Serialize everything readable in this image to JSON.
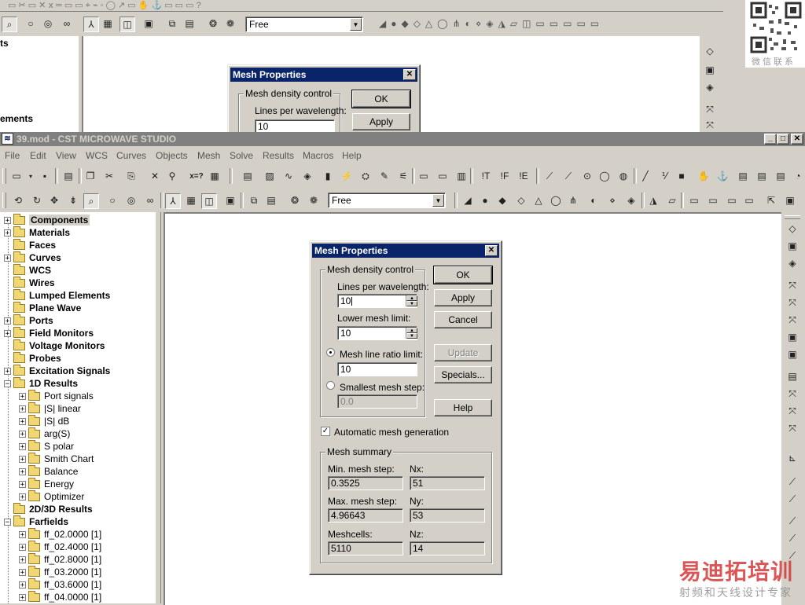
{
  "background_window": {
    "tree_partial": [
      "ts",
      "ements"
    ],
    "combo_value": "Free",
    "dialog": {
      "title": "Mesh Properties",
      "group_label": "Mesh density control",
      "lines_label": "Lines per wavelength:",
      "lines_value": "10",
      "ok": "OK",
      "apply": "Apply"
    }
  },
  "watermark": {
    "qr_caption": "微信联系",
    "brand": "易迪拓培训",
    "tagline": "射频和天线设计专家"
  },
  "window": {
    "title": "39.mod - CST MICROWAVE STUDIO",
    "controls": [
      "_",
      "□",
      "✕"
    ]
  },
  "menu": [
    "File",
    "Edit",
    "View",
    "WCS",
    "Curves",
    "Objects",
    "Mesh",
    "Solve",
    "Results",
    "Macros",
    "Help"
  ],
  "toolbar": {
    "combo_value": "Free"
  },
  "tree": {
    "items": [
      {
        "label": "Components",
        "expand": "+",
        "bold": true,
        "selected": true,
        "level": 0
      },
      {
        "label": "Materials",
        "expand": "+",
        "bold": true,
        "level": 0
      },
      {
        "label": "Faces",
        "expand": "",
        "bold": true,
        "level": 0
      },
      {
        "label": "Curves",
        "expand": "+",
        "bold": true,
        "level": 0
      },
      {
        "label": "WCS",
        "expand": "",
        "bold": true,
        "level": 0
      },
      {
        "label": "Wires",
        "expand": "",
        "bold": true,
        "level": 0
      },
      {
        "label": "Lumped Elements",
        "expand": "",
        "bold": true,
        "level": 0
      },
      {
        "label": "Plane Wave",
        "expand": "",
        "bold": true,
        "level": 0
      },
      {
        "label": "Ports",
        "expand": "+",
        "bold": true,
        "level": 0
      },
      {
        "label": "Field Monitors",
        "expand": "+",
        "bold": true,
        "level": 0
      },
      {
        "label": "Voltage Monitors",
        "expand": "",
        "bold": true,
        "level": 0
      },
      {
        "label": "Probes",
        "expand": "",
        "bold": true,
        "level": 0
      },
      {
        "label": "Excitation Signals",
        "expand": "+",
        "bold": true,
        "level": 0
      },
      {
        "label": "1D Results",
        "expand": "−",
        "bold": true,
        "level": 0
      },
      {
        "label": "Port signals",
        "expand": "+",
        "bold": false,
        "level": 1
      },
      {
        "label": "|S| linear",
        "expand": "+",
        "bold": false,
        "level": 1
      },
      {
        "label": "|S| dB",
        "expand": "+",
        "bold": false,
        "level": 1
      },
      {
        "label": "arg(S)",
        "expand": "+",
        "bold": false,
        "level": 1
      },
      {
        "label": "S polar",
        "expand": "+",
        "bold": false,
        "level": 1
      },
      {
        "label": "Smith Chart",
        "expand": "+",
        "bold": false,
        "level": 1
      },
      {
        "label": "Balance",
        "expand": "+",
        "bold": false,
        "level": 1
      },
      {
        "label": "Energy",
        "expand": "+",
        "bold": false,
        "level": 1
      },
      {
        "label": "Optimizer",
        "expand": "+",
        "bold": false,
        "level": 1
      },
      {
        "label": "2D/3D Results",
        "expand": "",
        "bold": true,
        "level": 0
      },
      {
        "label": "Farfields",
        "expand": "−",
        "bold": true,
        "level": 0
      },
      {
        "label": "ff_02.0000 [1]",
        "expand": "+",
        "bold": false,
        "level": 1
      },
      {
        "label": "ff_02.4000 [1]",
        "expand": "+",
        "bold": false,
        "level": 1
      },
      {
        "label": "ff_02.8000 [1]",
        "expand": "+",
        "bold": false,
        "level": 1
      },
      {
        "label": "ff_03.2000 [1]",
        "expand": "+",
        "bold": false,
        "level": 1
      },
      {
        "label": "ff_03.6000 [1]",
        "expand": "+",
        "bold": false,
        "level": 1
      },
      {
        "label": "ff_04.0000 [1]",
        "expand": "+",
        "bold": false,
        "level": 1
      }
    ]
  },
  "dialog": {
    "title": "Mesh Properties",
    "close": "✕",
    "density_group": "Mesh density control",
    "lines_label": "Lines per wavelength:",
    "lines_value": "10",
    "lower_label": "Lower mesh limit:",
    "lower_value": "10",
    "ratio_label": "Mesh line ratio limit:",
    "ratio_value": "10",
    "smallest_label": "Smallest mesh step:",
    "smallest_value": "0.0",
    "auto_label": "Automatic mesh generation",
    "auto_checked": true,
    "summary_group": "Mesh summary",
    "min_label": "Min. mesh step:",
    "min_value": "0.3525",
    "max_label": "Max. mesh step:",
    "max_value": "4.96643",
    "cells_label": "Meshcells:",
    "cells_value": "5110",
    "nx_label": "Nx:",
    "nx_value": "51",
    "ny_label": "Ny:",
    "ny_value": "53",
    "nz_label": "Nz:",
    "nz_value": "14",
    "buttons": {
      "ok": "OK",
      "apply": "Apply",
      "cancel": "Cancel",
      "update": "Update",
      "specials": "Specials...",
      "help": "Help"
    }
  },
  "icons": {
    "toolbar1": [
      "open",
      "save",
      "print",
      "copy",
      "cut",
      "paste",
      "delete",
      "pick",
      "x=?",
      "measure",
      "table",
      "chart",
      "wave",
      "plot",
      "port",
      "lumped",
      "field",
      "probe",
      "monitor",
      "scope",
      "config",
      "e-field",
      "h-field",
      "line",
      "slash",
      "circle",
      "target",
      "ring",
      "diag",
      "ratio",
      "stop",
      "hand",
      "anchor",
      "list",
      "list2",
      "list3",
      "help"
    ],
    "toolbar2": [
      "rotate",
      "spin",
      "pan",
      "dolly",
      "zoom-box",
      "zoom-in",
      "zoom-fit",
      "glasses",
      "axes",
      "grid",
      "cube",
      "box",
      "transform",
      "align",
      "solid",
      "mesh",
      "brick",
      "sphere",
      "cylinder",
      "cone",
      "torus",
      "extrude",
      "rotate-obj",
      "loft",
      "bend",
      "blend",
      "bool1",
      "bool2",
      "bool3",
      "bool4",
      "pick1",
      "pick2"
    ]
  }
}
